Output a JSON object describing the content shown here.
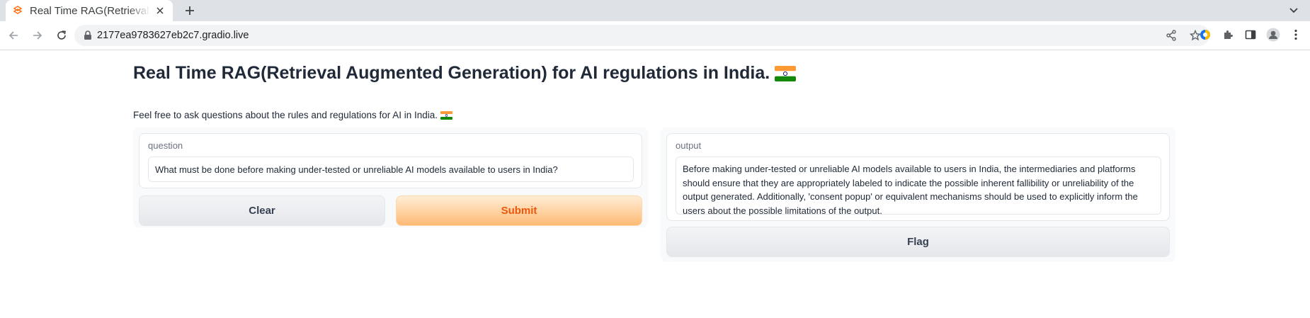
{
  "browser": {
    "tab_title": "Real Time RAG(Retrieval Augmented Generation) for AI regulations in India.",
    "url": "2177ea9783627eb2c7.gradio.live"
  },
  "page": {
    "title": "Real Time RAG(Retrieval Augmented Generation) for AI regulations in India.",
    "description": "Feel free to ask questions about the rules and regulations for AI in India.",
    "flag_icon": "india-flag-icon"
  },
  "input": {
    "label": "question",
    "value": "What must be done before making under-tested or unreliable AI models available to users in India?"
  },
  "output": {
    "label": "output",
    "value": "Before making under-tested or unreliable AI models available to users in India, the intermediaries and platforms should ensure that they are appropriately labeled to indicate the possible inherent fallibility or unreliability of the output generated. Additionally, 'consent popup' or equivalent mechanisms should be used to explicitly inform the users about the possible limitations of the output."
  },
  "buttons": {
    "clear": "Clear",
    "submit": "Submit",
    "flag": "Flag"
  },
  "colors": {
    "accent": "#ea580c",
    "submit_gradient_start": "#ffedd5",
    "submit_gradient_end": "#fdba74"
  }
}
